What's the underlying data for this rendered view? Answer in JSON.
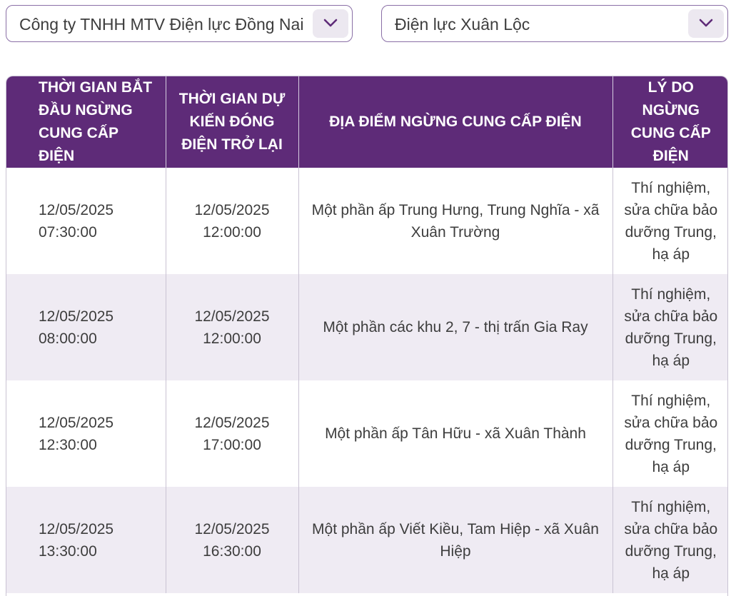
{
  "filters": {
    "company": "Công ty TNHH MTV Điện lực Đồng Nai",
    "branch": "Điện lực Xuân Lộc"
  },
  "table": {
    "headers": {
      "start": "THỜI GIAN BẮT ĐẦU NGỪNG CUNG CẤP ĐIỆN",
      "restore": "THỜI GIAN DỰ KIẾN ĐÓNG ĐIỆN TRỞ LẠI",
      "location": "ĐỊA ĐIỂM NGỪNG CUNG CẤP ĐIỆN",
      "reason": "LÝ DO NGỪNG CUNG CẤP ĐIỆN"
    },
    "rows": [
      {
        "start_date": "12/05/2025",
        "start_time": "07:30:00",
        "end_date": "12/05/2025",
        "end_time": "12:00:00",
        "location": "Một phần ấp Trung Hưng, Trung Nghĩa - xã Xuân Trường",
        "reason": "Thí nghiệm, sửa chữa bảo dưỡng Trung, hạ áp"
      },
      {
        "start_date": "12/05/2025",
        "start_time": "08:00:00",
        "end_date": "12/05/2025",
        "end_time": "12:00:00",
        "location": "Một phần các khu 2, 7 - thị trấn Gia Ray",
        "reason": "Thí nghiệm, sửa chữa bảo dưỡng Trung, hạ áp"
      },
      {
        "start_date": "12/05/2025",
        "start_time": "12:30:00",
        "end_date": "12/05/2025",
        "end_time": "17:00:00",
        "location": "Một phần ấp Tân Hữu - xã Xuân Thành",
        "reason": "Thí nghiệm, sửa chữa bảo dưỡng Trung, hạ áp"
      },
      {
        "start_date": "12/05/2025",
        "start_time": "13:30:00",
        "end_date": "12/05/2025",
        "end_time": "16:30:00",
        "location": "Một phần ấp Viết Kiều, Tam Hiệp - xã Xuân Hiệp",
        "reason": "Thí nghiệm, sửa chữa bảo dưỡng Trung, hạ áp"
      }
    ]
  },
  "colors": {
    "header_bg": "#5e2b78",
    "stripe_bg": "#efebf3",
    "select_border": "#8a6fa6",
    "chevron": "#5e2b78"
  },
  "icons": {
    "select_toggle": "chevron-down-icon"
  }
}
